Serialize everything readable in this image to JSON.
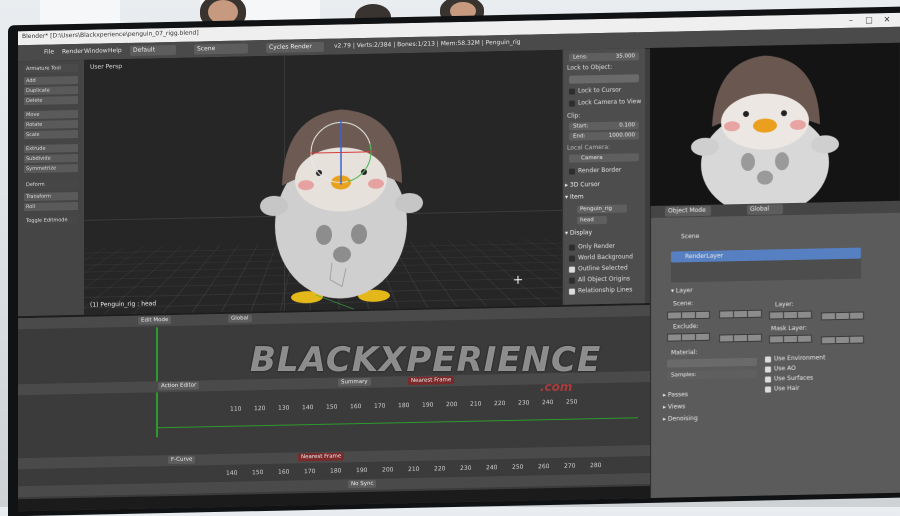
{
  "window": {
    "title": "Blender* [D:\\Users\\Blackxperience\\penguin_07_rigg.blend]",
    "scene": "Scene",
    "engine": "Cycles Render",
    "stats": "v2.79 | Verts:2/384 | Bones:1/213 | Mem:58.32M | Penguin_rig",
    "layout": "Default",
    "menus": [
      "File",
      "Render",
      "Window",
      "Help"
    ]
  },
  "viewport": {
    "label": "User Persp",
    "object_label": "(1) Penguin_rig : head",
    "mode": "Edit Mode",
    "orientation": "Global"
  },
  "toolshelf": {
    "tab": "Armature Tool",
    "items": [
      "Add",
      "Duplicate",
      "Delete",
      "Move",
      "Rotate",
      "Scale",
      "Extrude",
      "Subdivide",
      "Symmetrize"
    ],
    "sections": [
      "Deform",
      "Transform",
      "Roll",
      "Toggle Editmode"
    ]
  },
  "properties": {
    "lens_label": "Lens:",
    "lens_value": "35.000",
    "lock_to_object": "Lock to Object:",
    "lock_to_cursor": "Lock to Cursor",
    "lock_camera_to_view": "Lock Camera to View",
    "clip": "Clip:",
    "clip_start_label": "Start:",
    "clip_start": "0.100",
    "clip_end_label": "End:",
    "clip_end": "1000.000",
    "local_camera": "Local Camera:",
    "camera": "Camera",
    "render_border": "Render Border",
    "cursor_3d": "3D Cursor",
    "item": "Item",
    "item_name": "Penguin_rig",
    "bone_name": "head",
    "display": "Display",
    "only_render": "Only Render",
    "world_background": "World Background",
    "outline_selected": "Outline Selected",
    "all_object_origins": "All Object Origins",
    "relationship_lines": "Relationship Lines"
  },
  "render_panel": {
    "mode": "Object Mode",
    "orientation": "Global",
    "scene": "Scene",
    "render_layer": "RenderLayer",
    "layer_section": "Layer",
    "scene_label": "Scene:",
    "layer_label": "Layer:",
    "exclude_label": "Exclude:",
    "mask_layer_label": "Mask Layer:",
    "material_label": "Material:",
    "samples_label": "Samples:",
    "use_environment": "Use Environment",
    "use_ao": "Use AO",
    "use_surfaces": "Use Surfaces",
    "use_hair": "Use Hair",
    "passes": "Passes",
    "views": "Views",
    "denoising": "Denoising"
  },
  "action_editor": {
    "editor": "Action Editor",
    "mode": "Summary",
    "nearest_frame": "Nearest Frame",
    "ticks": [
      "110",
      "120",
      "130",
      "140",
      "150",
      "160",
      "170",
      "180",
      "190",
      "200",
      "210",
      "220",
      "230",
      "240",
      "250"
    ]
  },
  "timeline": {
    "fcurve": "F-Curve",
    "nearest_frame": "Nearest Frame",
    "no_sync": "No Sync",
    "ticks": [
      "140",
      "150",
      "160",
      "170",
      "180",
      "190",
      "200",
      "210",
      "220",
      "230",
      "240",
      "250",
      "260",
      "270",
      "280"
    ]
  },
  "watermark": {
    "text": "BLACKXPERIENCE",
    "suffix": ".com"
  },
  "colors": {
    "accent_blue": "#5680c2",
    "keyframe_green": "#2e9a2e",
    "watermark_red": "#c23a3a"
  }
}
